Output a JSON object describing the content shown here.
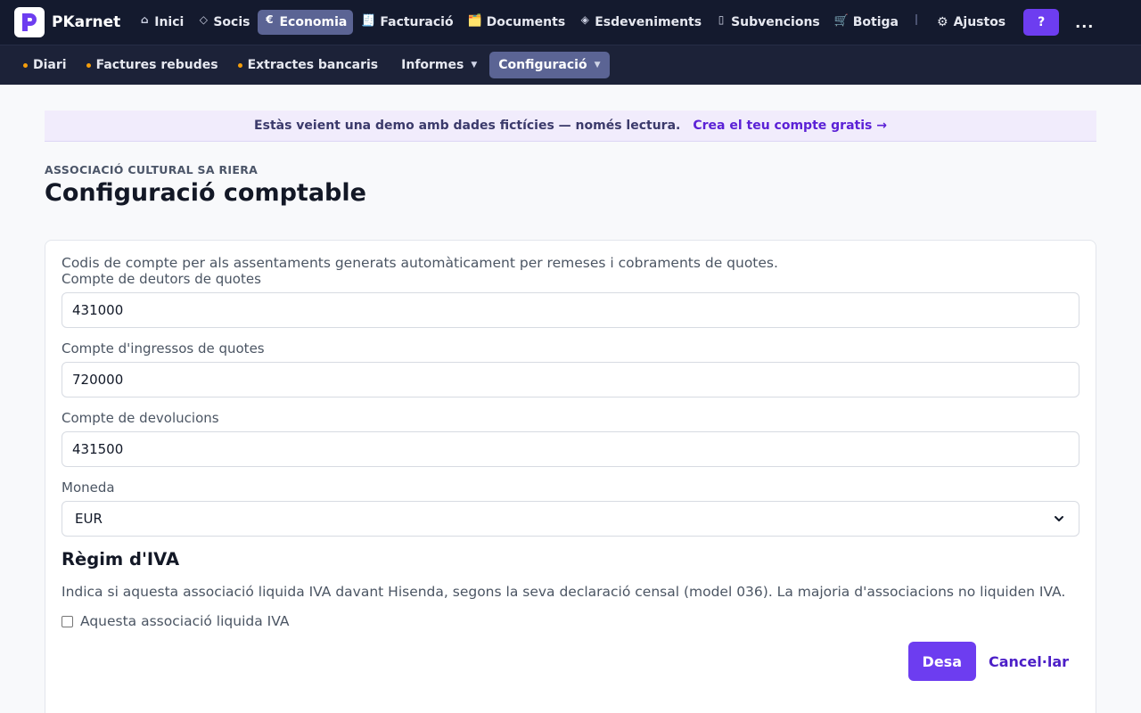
{
  "app": {
    "name": "PKarnet"
  },
  "nav": {
    "items": [
      {
        "label": "Inici",
        "icon": "⌂"
      },
      {
        "label": "Socis",
        "icon": "◇"
      },
      {
        "label": "Economia",
        "icon": "€"
      },
      {
        "label": "Facturació",
        "icon": "🧾"
      },
      {
        "label": "Documents",
        "icon": "🗂️"
      },
      {
        "label": "Esdeveniments",
        "icon": "◈"
      },
      {
        "label": "Subvencions",
        "icon": "▯"
      },
      {
        "label": "Botiga",
        "icon": "🛒"
      }
    ],
    "active": "Economia",
    "settings_label": "Ajustos",
    "settings_icon": "⚙",
    "help_label": "?",
    "more_label": "..."
  },
  "subnav": {
    "items": [
      {
        "label": "Diari"
      },
      {
        "label": "Factures rebudes"
      },
      {
        "label": "Extractes bancaris"
      },
      {
        "label": "Informes"
      },
      {
        "label": "Configuració"
      }
    ],
    "active": "Configuració"
  },
  "banner": {
    "text": "Estàs veient una demo amb dades fictícies — només lectura.",
    "link": "Crea el teu compte gratis →"
  },
  "page": {
    "org": "ASSOCIACIÓ CULTURAL SA RIERA",
    "title": "Configuració comptable"
  },
  "form": {
    "description": "Codis de compte per als assentaments generats automàticament per remeses i cobraments de quotes.",
    "fields": [
      {
        "label": "Compte de deutors de quotes",
        "value": "431000"
      },
      {
        "label": "Compte d'ingressos de quotes",
        "value": "720000"
      },
      {
        "label": "Compte de devolucions",
        "value": "431500"
      }
    ],
    "currency": {
      "label": "Moneda",
      "value": "EUR"
    },
    "vat": {
      "title": "Règim d'IVA",
      "description": "Indica si aquesta associació liquida IVA davant Hisenda, segons la seva declaració censal (model 036). La majoria d'associacions no liquiden IVA.",
      "checkbox_label": "Aquesta associació liquida IVA",
      "checked": false
    },
    "save_label": "Desa",
    "cancel_label": "Cancel·lar"
  },
  "colors": {
    "topbar": "#141a2e",
    "accent": "#6d3df0",
    "active_nav": "#5b6494",
    "subnav_dot": "#f59e0b"
  }
}
